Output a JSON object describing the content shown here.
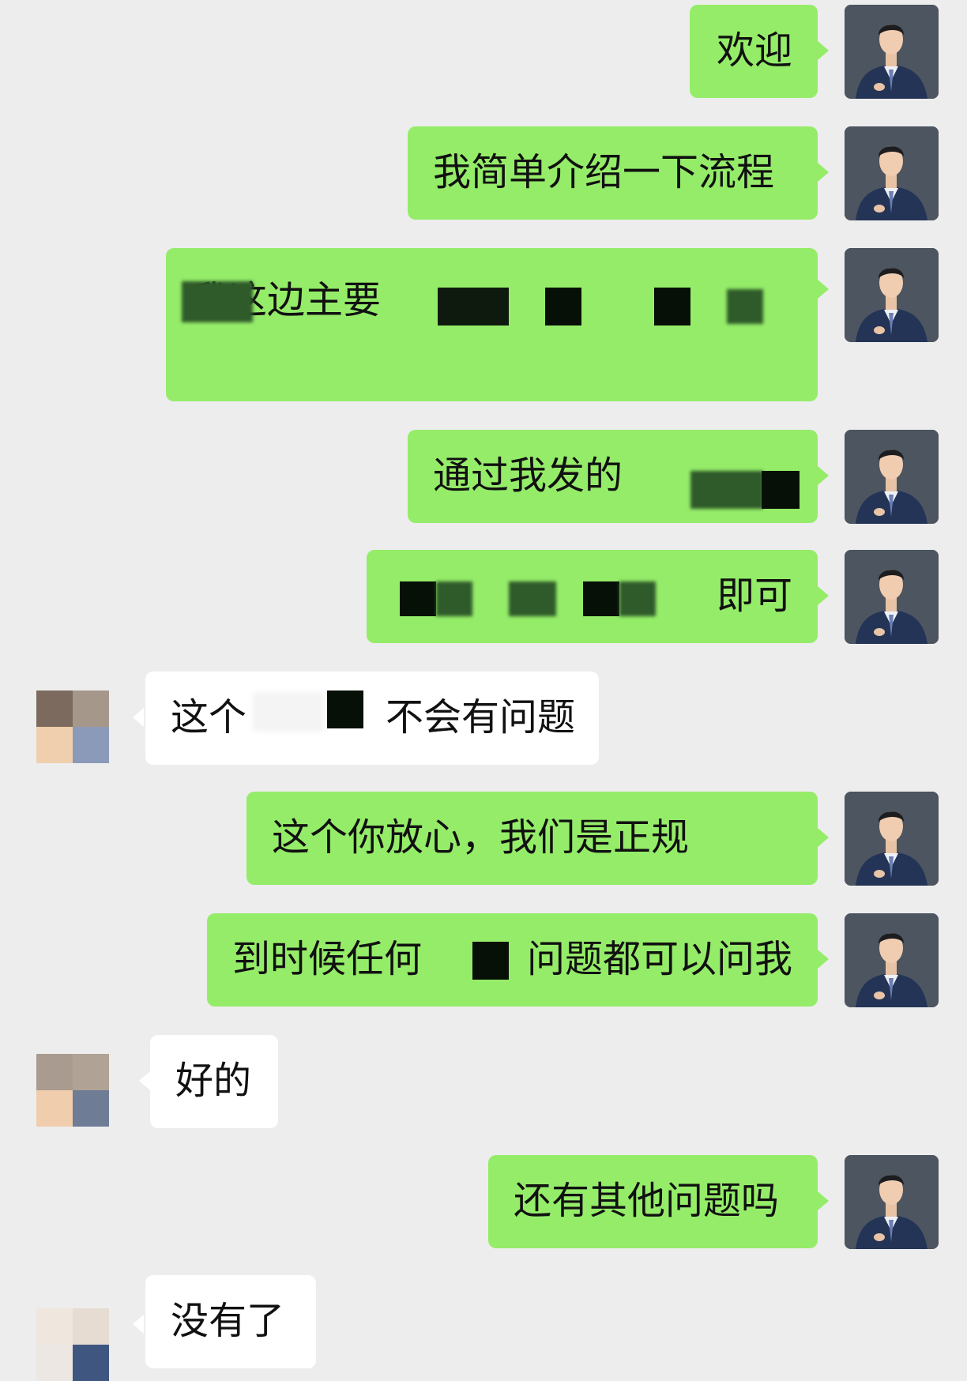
{
  "messages": [
    {
      "side": "out",
      "text": "欢迎"
    },
    {
      "side": "out",
      "text": "我简单介绍一下流程"
    },
    {
      "side": "out",
      "text": "我这边主要"
    },
    {
      "side": "out",
      "text": "通过我发的"
    },
    {
      "side": "out",
      "text_end": "即可"
    },
    {
      "side": "in",
      "text_start": "这个",
      "text_end": "不会有问题"
    },
    {
      "side": "out",
      "text": "这个你放心，我们是正规"
    },
    {
      "side": "out",
      "text_start": "到时候任何",
      "text_end": "问题都可以问我"
    },
    {
      "side": "in",
      "text": "好的"
    },
    {
      "side": "out",
      "text": "还有其他问题吗"
    },
    {
      "side": "in",
      "text": "没有了"
    }
  ],
  "colors": {
    "background": "#ededed",
    "outgoing_bubble": "#95ec69",
    "incoming_bubble": "#ffffff"
  },
  "icons": {
    "agent_avatar": "person-in-suit-photo",
    "user_avatar": "pixelated-avatar"
  }
}
